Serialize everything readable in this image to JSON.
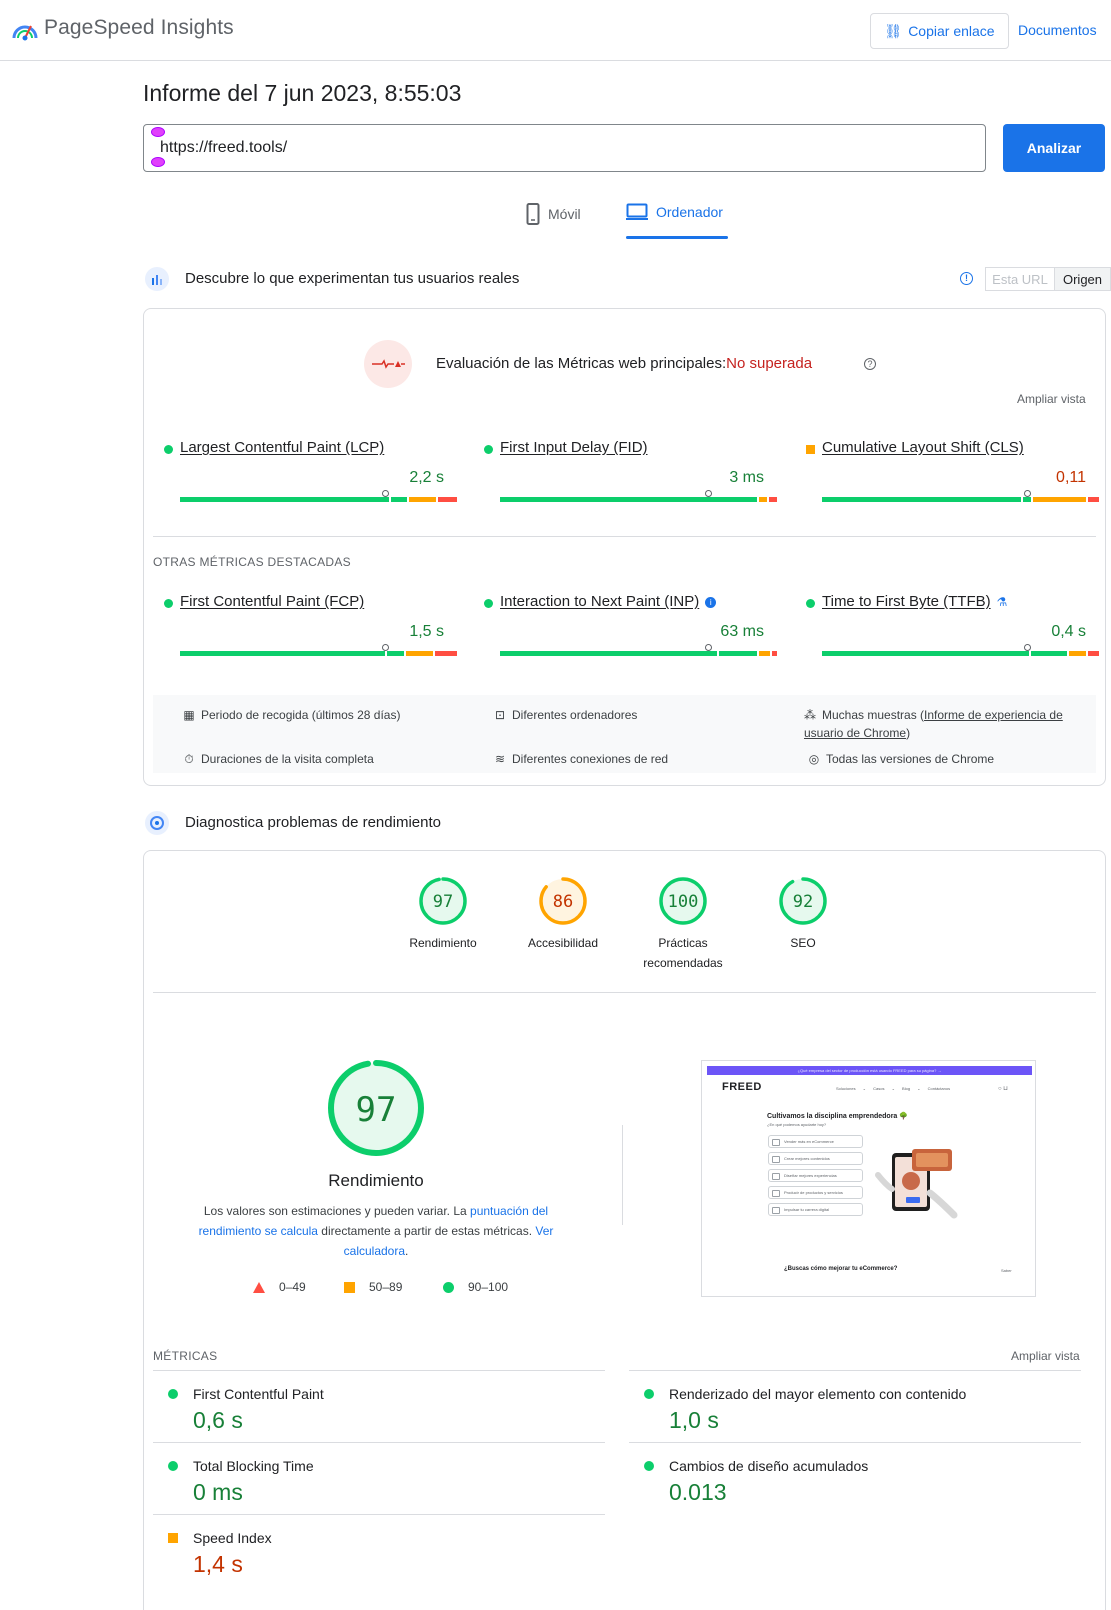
{
  "header": {
    "app_title": "PageSpeed Insights",
    "copy_link": "Copiar enlace",
    "docs": "Documentos"
  },
  "report": {
    "title": "Informe del 7 jun 2023, 8:55:03",
    "url": "https://freed.tools/",
    "analyze": "Analizar"
  },
  "device_tabs": [
    {
      "label": "Móvil",
      "active": false
    },
    {
      "label": "Ordenador",
      "active": true
    }
  ],
  "crux": {
    "section_title": "Descubre lo que experimentan tus usuarios reales",
    "toggle": {
      "url": "Esta URL",
      "origin": "Origen"
    },
    "assessment_label": "Evaluación de las Métricas web principales:",
    "assessment_status": "No superada",
    "expand": "Ampliar vista",
    "core_metrics": [
      {
        "name": "Largest Contentful Paint (LCP)",
        "value": "2,2 s",
        "rating": "good",
        "distribution": [
          0.77,
          0.06,
          0.1,
          0.07
        ],
        "marker": 0.74
      },
      {
        "name": "First Input Delay (FID)",
        "value": "3 ms",
        "rating": "good",
        "distribution": [
          0.94,
          0.03,
          0.03
        ],
        "marker": 0.75
      },
      {
        "name": "Cumulative Layout Shift (CLS)",
        "value": "0,11",
        "rating": "avg",
        "distribution": [
          0.72,
          0.03,
          0.19,
          0.04
        ],
        "marker": 0.74
      }
    ],
    "other_label": "OTRAS MÉTRICAS DESTACADAS",
    "other_metrics": [
      {
        "name": "First Contentful Paint (FCP)",
        "value": "1,5 s",
        "rating": "good",
        "extra": "",
        "distribution": [
          0.75,
          0.06,
          0.1,
          0.08
        ],
        "marker": 0.74
      },
      {
        "name": "Interaction to Next Paint (INP)",
        "value": "63 ms",
        "rating": "good",
        "extra": "info",
        "distribution": [
          0.81,
          0.14,
          0.04,
          0.02
        ],
        "marker": 0.75
      },
      {
        "name": "Time to First Byte (TTFB)",
        "value": "0,4 s",
        "rating": "good",
        "extra": "flask",
        "distribution": [
          0.75,
          0.13,
          0.06,
          0.04
        ],
        "marker": 0.74
      }
    ],
    "info": {
      "period": "Periodo de recogida (últimos 28 días)",
      "devices": "Diferentes ordenadores",
      "samples_prefix": "Muchas muestras (",
      "samples_link": "Informe de experiencia de usuario de Chrome",
      "samples_suffix": ")",
      "durations": "Duraciones de la visita completa",
      "connections": "Diferentes conexiones de red",
      "versions": "Todas las versiones de Chrome"
    }
  },
  "diagnostics": {
    "section_title": "Diagnostica problemas de rendimiento",
    "gauges": [
      {
        "label": "Rendimiento",
        "score": 97,
        "rating": "good"
      },
      {
        "label": "Accesibilidad",
        "score": 86,
        "rating": "avg"
      },
      {
        "label": "Prácticas recomendadas",
        "score": 100,
        "rating": "good"
      },
      {
        "label": "SEO",
        "score": 92,
        "rating": "good"
      }
    ],
    "big_score": 97,
    "big_label": "Rendimiento",
    "desc_1": "Los valores son estimaciones y pueden variar. La ",
    "desc_link_1": "puntuación del rendimiento se calcula",
    "desc_2": " directamente a partir de estas métricas. ",
    "desc_link_2": "Ver calculadora",
    "desc_3": ".",
    "legend": {
      "bad": "0–49",
      "avg": "50–89",
      "good": "90–100"
    },
    "screenshot": {
      "banner": "¿Qué empresa del sector de producción está usando FREED para su página? →",
      "brand": "FREED",
      "nav": "Soluciones ⌄   Casos ⌄   Blog ⌄   Contáctanos",
      "headline": "Cultivamos la disciplina emprendedora 🌳",
      "subhead": "¿En qué podemos ayudarte hoy?",
      "options": [
        "Vender más en eCommerce",
        "Crear mejores contenidos",
        "Diseñar mejores experiencias",
        "Producir de productos y servicios",
        "Impulsar tu carrera digital"
      ],
      "bottom": "¿Buscas cómo mejorar tu eCommerce?",
      "bottom_link": "Saber"
    },
    "metrics_label": "MÉTRICAS",
    "metrics_expand": "Ampliar vista",
    "metrics": [
      {
        "name": "First Contentful Paint",
        "value": "0,6 s",
        "rating": "good"
      },
      {
        "name": "Renderizado del mayor elemento con contenido",
        "value": "1,0 s",
        "rating": "good"
      },
      {
        "name": "Total Blocking Time",
        "value": "0 ms",
        "rating": "good"
      },
      {
        "name": "Cambios de diseño acumulados",
        "value": "0.013",
        "rating": "good"
      },
      {
        "name": "Speed Index",
        "value": "1,4 s",
        "rating": "avg"
      }
    ]
  },
  "colors": {
    "good": "#0cce6b",
    "avg": "#ffa400",
    "bad": "#ff4e42",
    "accent": "#1a73e8"
  }
}
